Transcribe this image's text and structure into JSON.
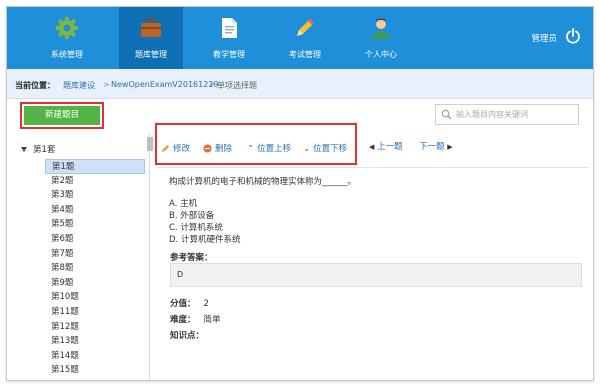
{
  "nav": {
    "items": [
      {
        "label": "系统管理",
        "icon": "gear-icon"
      },
      {
        "label": "题库管理",
        "icon": "briefcase-icon"
      },
      {
        "label": "教学管理",
        "icon": "document-icon"
      },
      {
        "label": "考试管理",
        "icon": "pencil-icon"
      },
      {
        "label": "个人中心",
        "icon": "user-icon"
      }
    ],
    "active_index": 1,
    "admin_label": "管理员",
    "accent": "#1e8fd8"
  },
  "breadcrumb": {
    "label": "当前位置：",
    "items": [
      "题库建设",
      "NewOpenExamV20161229",
      "单项选择题"
    ],
    "sep": ">"
  },
  "toolbar": {
    "new_label": "新建题目",
    "search_placeholder": "输入题目内容关键词"
  },
  "tree": {
    "root_label": "第1套",
    "items": [
      "第1题",
      "第2题",
      "第3题",
      "第4题",
      "第5题",
      "第6题",
      "第7题",
      "第8题",
      "第9题",
      "第10题",
      "第11题",
      "第12题",
      "第13题",
      "第14题",
      "第15题"
    ],
    "selected_index": 0
  },
  "actions": {
    "edit": "修改",
    "delete": "删除",
    "move_up": "位置上移",
    "move_down": "位置下移",
    "prev": "上一题",
    "next": "下一题"
  },
  "question": {
    "stem": "构成计算机的电子和机械的物理实体称为______。",
    "options": [
      "A. 主机",
      "B. 外部设备",
      "C. 计算机系统",
      "D. 计算机硬件系统"
    ],
    "answer_label": "参考答案：",
    "answer": "D",
    "score_label": "分值：",
    "score": "2",
    "difficulty_label": "难度：",
    "difficulty": "简单",
    "knowledge_label": "知识点："
  }
}
